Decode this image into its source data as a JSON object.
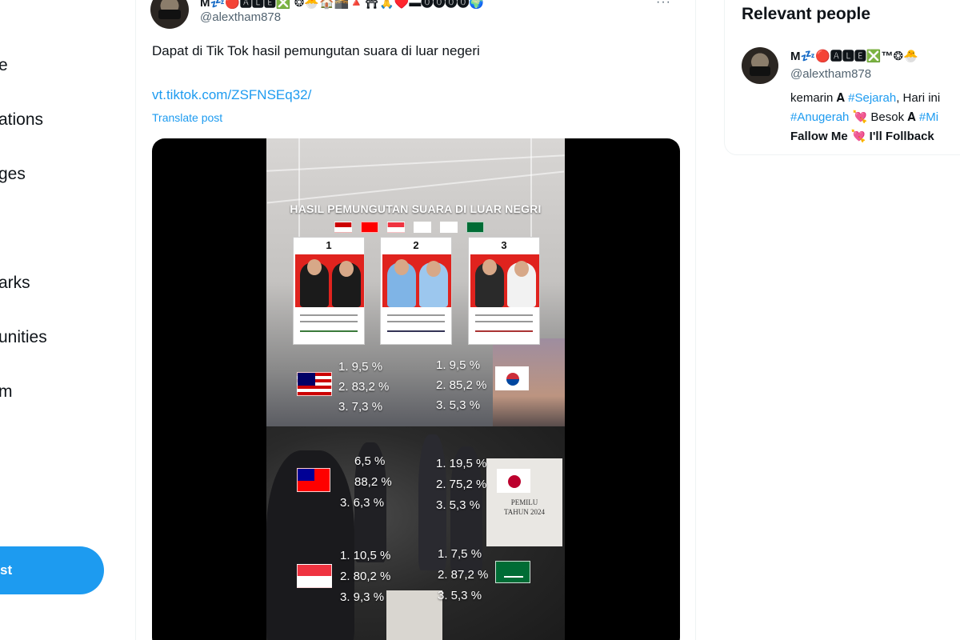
{
  "nav": {
    "items": [
      {
        "label": "e"
      },
      {
        "label": "ations"
      },
      {
        "label": "ges"
      },
      {
        "label": "arks"
      },
      {
        "label": "unities"
      },
      {
        "label": "m"
      }
    ],
    "post_button": "st"
  },
  "tweet": {
    "display_name": "M💤🔴🅰🅻🅴❎ ❂🐣🏠🕋🔺⛩🙏♥️▬⓿⓿⓿⓿🌍",
    "handle": "@alextham878",
    "more": "···",
    "text": "Dapat di Tik Tok hasil pemungutan suara di luar negeri",
    "link": "vt.tiktok.com/ZSFNSEq32/",
    "translate": "Translate post"
  },
  "video": {
    "title": "HASIL PEMUNGUTAN SUARA DI LUAR NEGRI",
    "candidates": [
      {
        "num": "1"
      },
      {
        "num": "2"
      },
      {
        "num": "3"
      }
    ],
    "results": [
      {
        "country": "Malaysia",
        "flag": "malaysia-flag-icon",
        "lines": [
          "1. 9,5 %",
          "2. 83,2 %",
          "3. 7,3 %"
        ]
      },
      {
        "country": "Korea",
        "flag": "korea-flag-icon",
        "lines": [
          "1. 9,5 %",
          "2. 85,2 %",
          "3. 5,3 %"
        ]
      },
      {
        "country": "Taiwan",
        "flag": "taiwan-flag-icon",
        "lines": [
          "6,5 %",
          "88,2 %",
          "3. 6,3 %"
        ]
      },
      {
        "country": "Japan",
        "flag": "japan-flag-icon",
        "lines": [
          "1. 19,5 %",
          "2. 75,2 %",
          "3. 5,3 %"
        ]
      },
      {
        "country": "Singapore",
        "flag": "singapore-flag-icon",
        "lines": [
          "1. 10,5 %",
          "2. 80,2 %",
          "3. 9,3 %"
        ]
      },
      {
        "country": "Saudi Arabia",
        "flag": "saudi-flag-icon",
        "lines": [
          "1. 7,5 %",
          "2. 87,2 %",
          "3. 5,3 %"
        ]
      }
    ],
    "box_text": [
      "PEMILU",
      "TAHUN 2024"
    ]
  },
  "relevant_people": {
    "title": "Relevant people",
    "name": "M💤🔴🅰🅻🅴❎™❂🐣",
    "handle": "@alextham878",
    "bio_line1_pre": "kemarin 𝐀 ",
    "bio_line1_tag": "#Sejarah",
    "bio_line1_post": ", Hari ini",
    "bio_line2_tag": "#Anugerah",
    "bio_line2_mid": " 💘 Besok 𝐀 ",
    "bio_line2_tag2": "#Mi",
    "bio_line3": "Fallow Me 💘 I'll Follback"
  },
  "colors": {
    "accent": "#1d9bf0",
    "text": "#0f1419",
    "muted": "#536471"
  }
}
